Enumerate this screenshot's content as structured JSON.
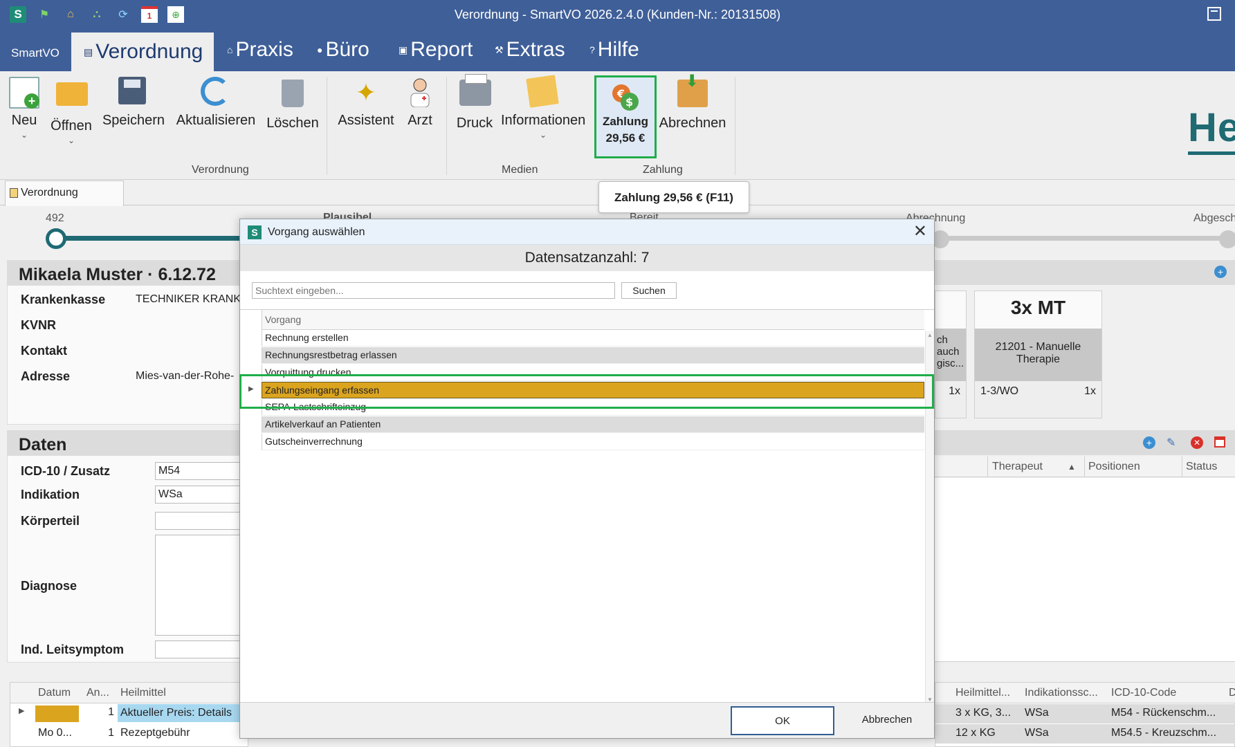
{
  "window": {
    "title": "Verordnung - SmartVO 2026.2.4.0 (Kunden-Nr.: 20131508)",
    "app_logo": "S",
    "icons": [
      "flag-icon",
      "home-icon",
      "network-icon",
      "sync-icon",
      "calendar-icon",
      "add-window-icon",
      "restore-icon"
    ],
    "calendar_day": "1"
  },
  "tabs": {
    "smartvo": "SmartVO",
    "verordnung": "Verordnung",
    "praxis": "Praxis",
    "buero": "Büro",
    "report": "Report",
    "extras": "Extras",
    "hilfe": "Hilfe"
  },
  "ribbon": {
    "neu": "Neu",
    "oeffnen": "Öffnen",
    "speichern": "Speichern",
    "aktualisieren": "Aktualisieren",
    "loeschen": "Löschen",
    "assistent": "Assistent",
    "arzt": "Arzt",
    "druck": "Druck",
    "informationen": "Informationen",
    "zahlung_line1": "Zahlung",
    "zahlung_line2": "29,56 €",
    "abrechnen": "Abrechnen",
    "group_verordnung": "Verordnung",
    "group_medien": "Medien",
    "group_zahlung": "Zahlung",
    "brand": "He",
    "accent": "#1fae4a"
  },
  "tooltip": "Zahlung 29,56 € (F11)",
  "doc_tab": "Verordnung",
  "progress": {
    "number": "492",
    "step_plausibel": "Plausibel",
    "step_bereit": "Bereit",
    "step_abrechnung": "Abrechnung",
    "step_abgeschlossen": "Abgesch"
  },
  "patient": {
    "header": "Mikaela Muster · 6.12.72",
    "krankenkasse_label": "Krankenkasse",
    "krankenkasse_value": "TECHNIKER KRANK",
    "kvnr_label": "KVNR",
    "kontakt_label": "Kontakt",
    "adresse_label": "Adresse",
    "adresse_value": "Mies-van-der-Rohe-"
  },
  "daten": {
    "header": "Daten",
    "icd_label": "ICD-10 / Zusatz",
    "icd_value": "M54",
    "indikation_label": "Indikation",
    "indikation_value": "WSa",
    "koerperteil_label": "Körperteil",
    "diagnose_label": "Diagnose",
    "leitsymptom_label": "Ind. Leitsymptom"
  },
  "cards": {
    "card1_body": "ch\nauch\ngisc...",
    "card1_count": "1x",
    "card2_title": "3x MT",
    "card2_body": "21201 - Manuelle Therapie",
    "card2_freq": "1-3/WO",
    "card2_count": "1x"
  },
  "therapist_table": {
    "col_therapeut": "Therapeut",
    "col_positionen": "Positionen",
    "col_status": "Status"
  },
  "left_grid": {
    "col_datum": "Datum",
    "col_an": "An...",
    "col_heilmittel": "Heilmittel",
    "row1_an": "1",
    "row1_heilmittel": "Aktueller Preis: Details",
    "row2_datum": "Mo 0...",
    "row2_an": "1",
    "row2_heilmittel": "Rezeptgebühr"
  },
  "right_grid": {
    "col_heilmittel": "Heilmittel...",
    "col_indikation": "Indikationssc...",
    "col_icd": "ICD-10-Code",
    "col_d": "D",
    "row1_heilmittel": "3 x KG, 3...",
    "row1_indikation": "WSa",
    "row1_icd": "M54 - Rückenschm...",
    "row2_heilmittel": "12 x KG",
    "row2_indikation": "WSa",
    "row2_icd": "M54.5 - Kreuzschm..."
  },
  "dialog": {
    "title": "Vorgang auswählen",
    "logo": "S",
    "count": "Datensatzanzahl: 7",
    "search_placeholder": "Suchtext eingeben...",
    "search_button": "Suchen",
    "column": "Vorgang",
    "rows": [
      "Rechnung erstellen",
      "Rechnungsrestbetrag erlassen",
      "Vorquittung drucken",
      "Zahlungseingang erfassen",
      "SEPA-Lastschrifteinzug",
      "Artikelverkauf an Patienten",
      "Gutscheinverrechnung"
    ],
    "selected_index": 3,
    "ok": "OK",
    "cancel": "Abbrechen",
    "selected_color": "#dba41f"
  }
}
